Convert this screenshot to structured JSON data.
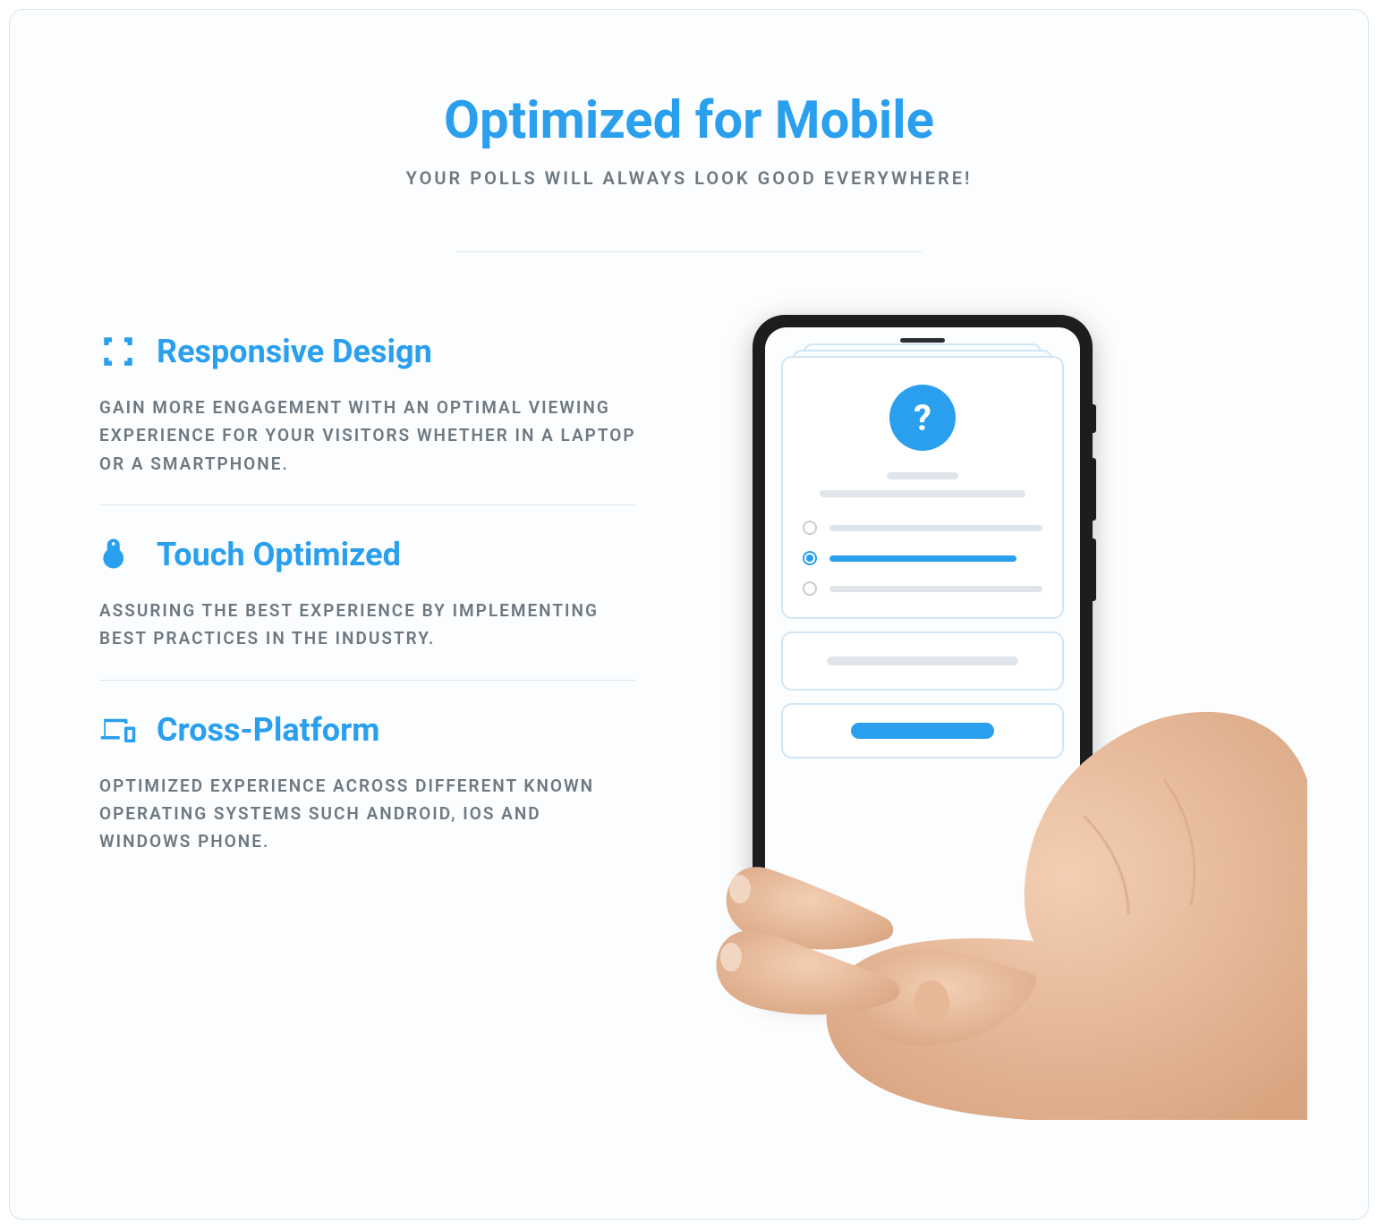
{
  "header": {
    "title": "Optimized for Mobile",
    "subtitle": "Your polls will always look good everywhere!"
  },
  "features": [
    {
      "icon": "expand-icon",
      "title": "Responsive Design",
      "desc": "Gain more engagement with an optimal viewing experience for your visitors whether in a laptop or a smartphone."
    },
    {
      "icon": "touch-icon",
      "title": "Touch Optimized",
      "desc": "Assuring the best experience by implementing best practices in the industry."
    },
    {
      "icon": "devices-icon",
      "title": "Cross-Platform",
      "desc": "Optimized experience across different known operating systems such Android, iOS and Windows phone."
    }
  ],
  "poll_placeholder": "?"
}
